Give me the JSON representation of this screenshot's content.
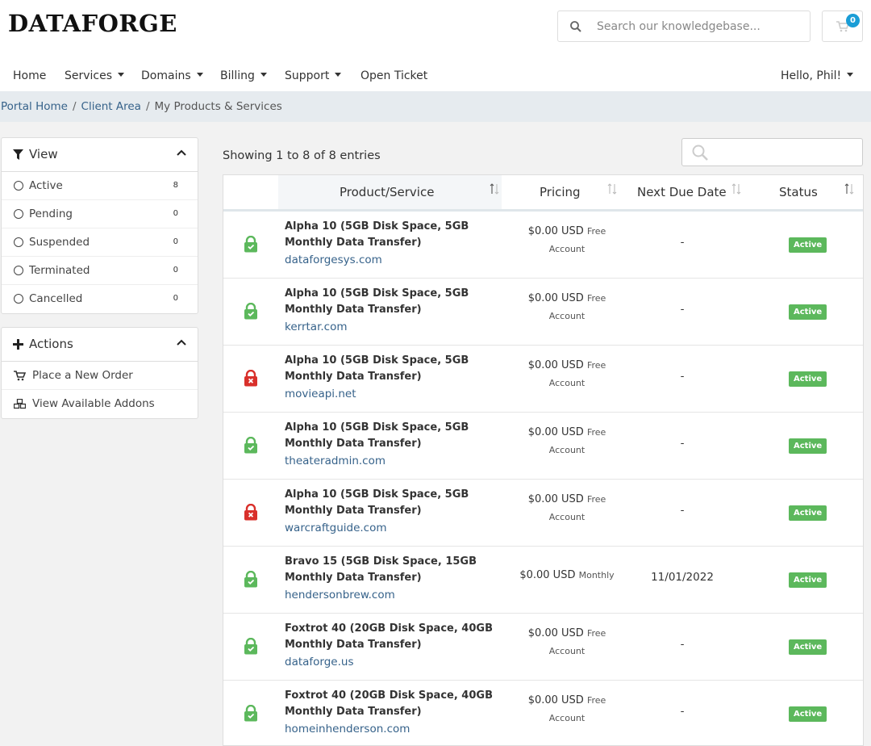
{
  "header": {
    "logo": "DATAFORGE",
    "search_placeholder": "Search our knowledgebase...",
    "cart_count": "0"
  },
  "nav": {
    "items": [
      {
        "label": "Home",
        "dropdown": false
      },
      {
        "label": "Services",
        "dropdown": true
      },
      {
        "label": "Domains",
        "dropdown": true
      },
      {
        "label": "Billing",
        "dropdown": true
      },
      {
        "label": "Support",
        "dropdown": true
      },
      {
        "label": "Open Ticket",
        "dropdown": false
      }
    ],
    "user": "Hello, Phil!"
  },
  "breadcrumb": {
    "items": [
      "Portal Home",
      "Client Area"
    ],
    "separator": "/",
    "current": "My Products & Services"
  },
  "sidebar": {
    "view": {
      "title": "View",
      "items": [
        {
          "label": "Active",
          "count": "8"
        },
        {
          "label": "Pending",
          "count": "0"
        },
        {
          "label": "Suspended",
          "count": "0"
        },
        {
          "label": "Terminated",
          "count": "0"
        },
        {
          "label": "Cancelled",
          "count": "0"
        }
      ]
    },
    "actions": {
      "title": "Actions",
      "items": [
        {
          "label": "Place a New Order",
          "icon": "cart-icon"
        },
        {
          "label": "View Available Addons",
          "icon": "cubes-icon"
        }
      ]
    }
  },
  "table": {
    "showing": "Showing 1 to 8 of 8 entries",
    "headers": {
      "product": "Product/Service",
      "pricing": "Pricing",
      "due": "Next Due Date",
      "status": "Status"
    },
    "rows": [
      {
        "product": "Alpha 10 (5GB Disk Space, 5GB Monthly Data Transfer)",
        "domain": "dataforgesys.com",
        "price": "$0.00 USD",
        "cycle_a": "Free",
        "cycle_b": "Account",
        "due": "-",
        "status": "Active",
        "ssl": "valid"
      },
      {
        "product": "Alpha 10 (5GB Disk Space, 5GB Monthly Data Transfer)",
        "domain": "kerrtar.com",
        "price": "$0.00 USD",
        "cycle_a": "Free",
        "cycle_b": "Account",
        "due": "-",
        "status": "Active",
        "ssl": "valid"
      },
      {
        "product": "Alpha 10 (5GB Disk Space, 5GB Monthly Data Transfer)",
        "domain": "movieapi.net",
        "price": "$0.00 USD",
        "cycle_a": "Free",
        "cycle_b": "Account",
        "due": "-",
        "status": "Active",
        "ssl": "invalid"
      },
      {
        "product": "Alpha 10 (5GB Disk Space, 5GB Monthly Data Transfer)",
        "domain": "theateradmin.com",
        "price": "$0.00 USD",
        "cycle_a": "Free",
        "cycle_b": "Account",
        "due": "-",
        "status": "Active",
        "ssl": "valid"
      },
      {
        "product": "Alpha 10 (5GB Disk Space, 5GB Monthly Data Transfer)",
        "domain": "warcraftguide.com",
        "price": "$0.00 USD",
        "cycle_a": "Free",
        "cycle_b": "Account",
        "due": "-",
        "status": "Active",
        "ssl": "invalid"
      },
      {
        "product": "Bravo 15 (5GB Disk Space, 15GB Monthly Data Transfer)",
        "domain": "hendersonbrew.com",
        "price": "$0.00 USD",
        "cycle_a": "Monthly",
        "cycle_b": "",
        "due": "11/01/2022",
        "status": "Active",
        "ssl": "valid"
      },
      {
        "product": "Foxtrot 40 (20GB Disk Space, 40GB Monthly Data Transfer)",
        "domain": "dataforge.us",
        "price": "$0.00 USD",
        "cycle_a": "Free",
        "cycle_b": "Account",
        "due": "-",
        "status": "Active",
        "ssl": "valid"
      },
      {
        "product": "Foxtrot 40 (20GB Disk Space, 40GB Monthly Data Transfer)",
        "domain": "homeinhenderson.com",
        "price": "$0.00 USD",
        "cycle_a": "Free",
        "cycle_b": "Account",
        "due": "-",
        "status": "Active",
        "ssl": "valid"
      }
    ]
  },
  "colors": {
    "accent_link": "#36628a",
    "status_active": "#5cb85c",
    "ssl_valid": "#5cb85c",
    "ssl_invalid": "#d9302b",
    "cart_badge": "#1a9dd6"
  }
}
